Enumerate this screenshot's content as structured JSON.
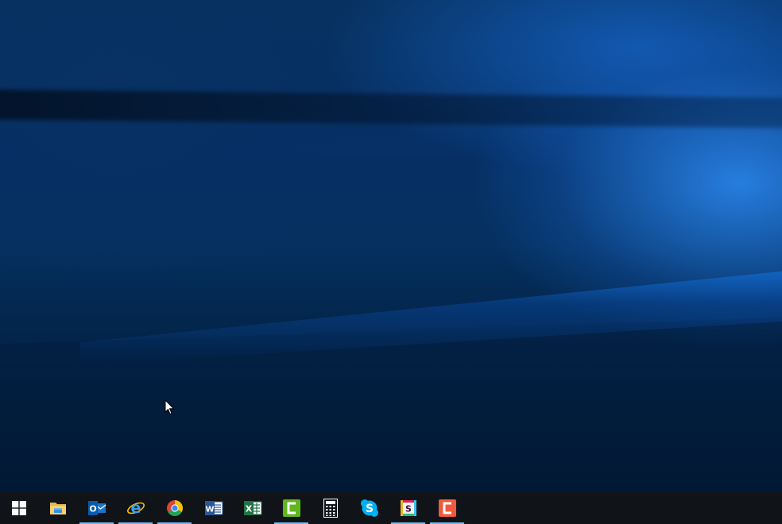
{
  "desktop": {
    "wallpaper": "windows-10-hero",
    "colors": {
      "base": "#05305f",
      "highlight": "#2882e6",
      "shadow": "#021c3b"
    }
  },
  "taskbar": {
    "background": "#101418",
    "indicator_color": "#76b9ed",
    "items": [
      {
        "name": "start-button",
        "icon": "windows-logo-icon",
        "running": false
      },
      {
        "name": "file-explorer-button",
        "icon": "folder-icon",
        "running": false
      },
      {
        "name": "outlook-button",
        "icon": "outlook-icon",
        "running": true,
        "glyph": "O"
      },
      {
        "name": "internet-explorer-button",
        "icon": "internet-explorer-icon",
        "running": true,
        "glyph": "e"
      },
      {
        "name": "chrome-button",
        "icon": "chrome-icon",
        "running": true
      },
      {
        "name": "word-button",
        "icon": "word-icon",
        "running": false,
        "glyph": "W"
      },
      {
        "name": "excel-button",
        "icon": "excel-icon",
        "running": false,
        "glyph": "X"
      },
      {
        "name": "camtasia-button",
        "icon": "camtasia-icon",
        "running": true
      },
      {
        "name": "calculator-button",
        "icon": "calculator-icon",
        "running": false
      },
      {
        "name": "skype-button",
        "icon": "skype-icon",
        "running": false,
        "glyph": "S"
      },
      {
        "name": "slack-button",
        "icon": "slack-icon",
        "running": true,
        "glyph": "S"
      },
      {
        "name": "snagit-button",
        "icon": "snagit-icon",
        "running": true
      }
    ]
  }
}
